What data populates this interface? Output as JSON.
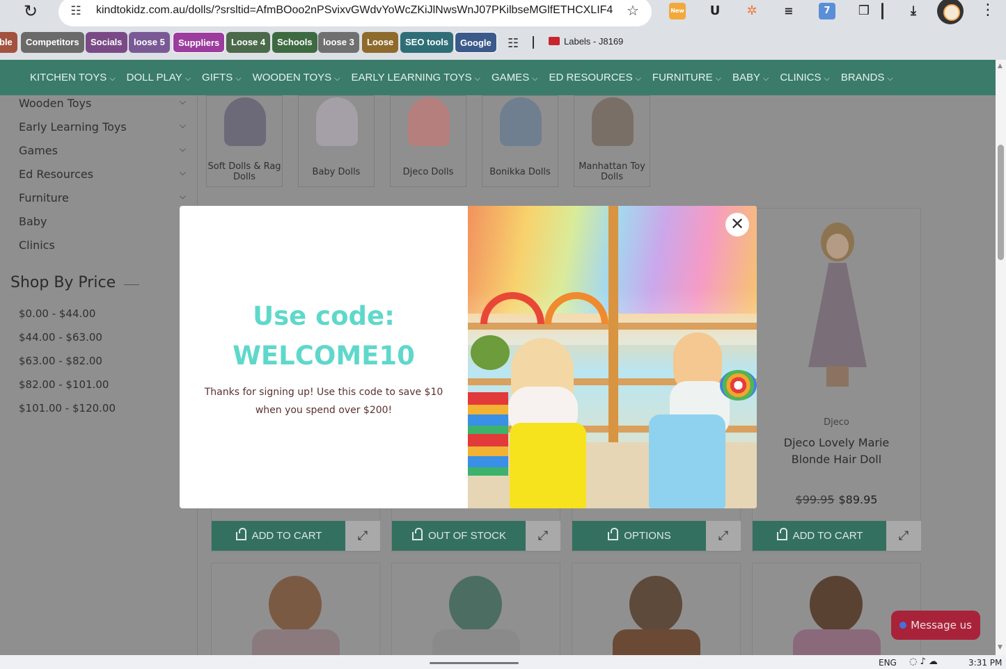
{
  "browser": {
    "url": "kindtokidz.com.au/dolls/?srsltid=AfmBOoo2nPSvixvGWdvYoWcZKiJlNwsWnJ07PKilbseMGlfETHCXLIF4",
    "extensions": [
      {
        "icon": "new-extension-icon",
        "badge": "New"
      },
      {
        "icon": "u-extension-icon",
        "label": "U"
      },
      {
        "icon": "hubspot-icon"
      },
      {
        "icon": "layers-icon"
      },
      {
        "icon": "grammar-extension-icon",
        "badge": "7"
      },
      {
        "icon": "puzzle-icon"
      },
      {
        "icon": "download-icon"
      }
    ]
  },
  "bookmarks": [
    {
      "label": "ble",
      "color": "#a2523e"
    },
    {
      "label": "Competitors",
      "color": "#6a6a6a"
    },
    {
      "label": "Socials",
      "color": "#7a4a86"
    },
    {
      "label": "loose 5",
      "color": "#7a5a95"
    },
    {
      "label": "Suppliers",
      "color": "#9b3c9e"
    },
    {
      "label": "Loose 4",
      "color": "#4a6a4a"
    },
    {
      "label": "Schools",
      "color": "#3e6a42"
    },
    {
      "label": "loose 3",
      "color": "#707070"
    },
    {
      "label": "Loose",
      "color": "#8e6a2c"
    },
    {
      "label": "SEO tools",
      "color": "#2f6e77"
    },
    {
      "label": "Google",
      "color": "#3b5a8a"
    }
  ],
  "bookmark_labels_item": "Labels - J8169",
  "nav": {
    "items": [
      "KITCHEN TOYS",
      "DOLL PLAY",
      "GIFTS",
      "WOODEN TOYS",
      "EARLY LEARNING TOYS",
      "GAMES",
      "ED RESOURCES",
      "FURNITURE",
      "BABY",
      "CLINICS",
      "BRANDS"
    ]
  },
  "sidebar": {
    "categories": [
      "Wooden Toys",
      "Early Learning Toys",
      "Games",
      "Ed Resources",
      "Furniture",
      "Baby",
      "Clinics"
    ],
    "price_heading": "Shop By Price",
    "price_ranges": [
      "$0.00 - $44.00",
      "$44.00 - $63.00",
      "$63.00 - $82.00",
      "$82.00 - $101.00",
      "$101.00 - $120.00"
    ]
  },
  "subcategories": [
    {
      "label": "Soft Dolls & Rag Dolls",
      "color": "#6c6a78"
    },
    {
      "label": "Baby Dolls",
      "color": "#a5a0a8"
    },
    {
      "label": "Djeco Dolls",
      "color": "#b57f7d"
    },
    {
      "label": "Bonikka Dolls",
      "color": "#6f7f8f"
    },
    {
      "label": "Manhattan Toy Dolls",
      "color": "#7a6f67"
    }
  ],
  "featured_product": {
    "brand": "Djeco",
    "name": "Djeco Lovely Marie Blonde Hair Doll",
    "old_price": "$99.95",
    "price": "$89.95"
  },
  "card_buttons": [
    {
      "label": "ADD TO CART"
    },
    {
      "label": "OUT OF STOCK"
    },
    {
      "label": "OPTIONS"
    },
    {
      "label": "ADD TO CART"
    }
  ],
  "second_row_colors": [
    {
      "head": "#7b5a44",
      "body": "#8a7a7d"
    },
    {
      "head": "#4c6e62",
      "body": "#8a8a8a"
    },
    {
      "head": "#5e4a3a",
      "body": "#6a4a35"
    },
    {
      "head": "#5a4232",
      "body": "#8a6a7a"
    }
  ],
  "modal": {
    "heading_line1": "Use code:",
    "heading_line2": "WELCOME10",
    "message": "Thanks for signing up! Use this code to save $10 when you spend over $200!",
    "close_icon": "close-icon"
  },
  "chat": {
    "label": "Message us"
  },
  "taskbar": {
    "language": "ENG",
    "time": "3:31 PM"
  }
}
